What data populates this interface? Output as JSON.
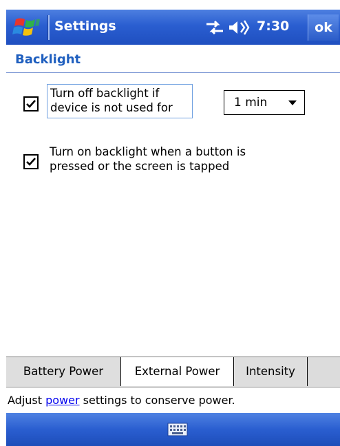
{
  "titlebar": {
    "title": "Settings",
    "time": "7:30",
    "ok_label": "ok",
    "icons": {
      "start": "windows-flag-icon",
      "connectivity": "connectivity-icon",
      "volume": "volume-icon"
    }
  },
  "page": {
    "title": "Backlight"
  },
  "options": [
    {
      "label_line1": "Turn off backlight if",
      "label_line2": "device is not used for",
      "checked": true,
      "select_value": "1 min"
    },
    {
      "label_line1": "Turn on backlight when a button is",
      "label_line2": "pressed or the screen is tapped",
      "checked": true
    }
  ],
  "tabs": [
    {
      "label": "Battery Power",
      "active": false
    },
    {
      "label": "External Power",
      "active": true
    },
    {
      "label": "Intensity",
      "active": false
    }
  ],
  "status": {
    "prefix": "Adjust ",
    "link": "power",
    "suffix": " settings to conserve power."
  },
  "bottombar": {
    "icon": "keyboard-icon"
  },
  "colors": {
    "titlebar": "#2a5ed0",
    "page_title": "#1f5fbf",
    "link": "#0000ee"
  }
}
